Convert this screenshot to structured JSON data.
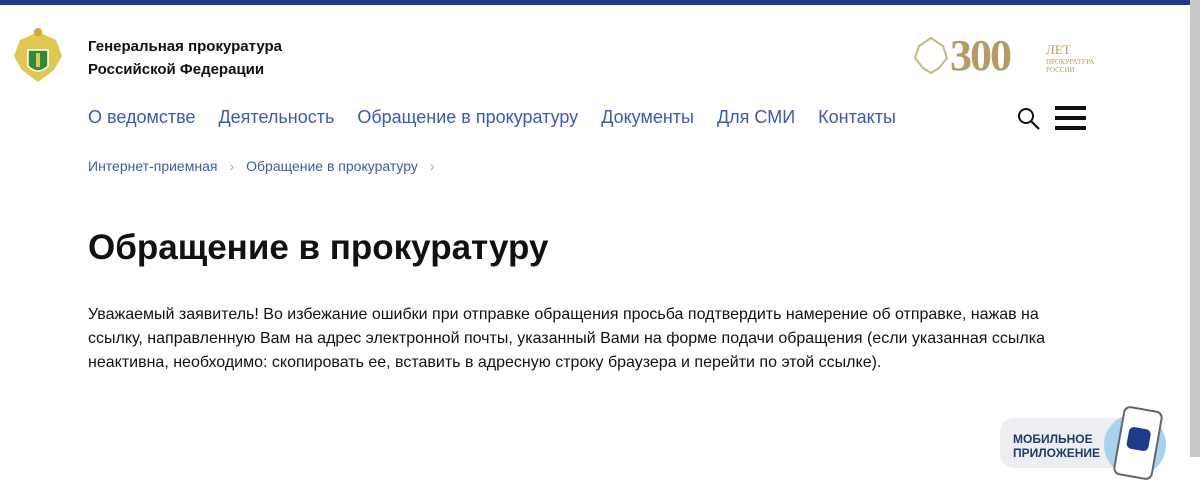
{
  "header": {
    "org_line1": "Генеральная прокуратура",
    "org_line2": "Российской Федерации",
    "jubilee": {
      "number": "300",
      "line1": "ЛЕТ",
      "line2": "ПРОКУРАТУРА",
      "line3": "РОССИИ"
    }
  },
  "nav": [
    "О ведомстве",
    "Деятельность",
    "Обращение в прокуратуру",
    "Документы",
    "Для СМИ",
    "Контакты"
  ],
  "breadcrumbs": [
    "Интернет-приемная",
    "Обращение в прокуратуру"
  ],
  "page": {
    "title": "Обращение в прокуратуру",
    "notice": "Уважаемый заявитель! Во избежание ошибки при отправке обращения просьба подтвердить намерение об отправке, нажав на ссылку, направленную Вам на адрес электронной почты, указанный Вами на форме подачи обращения (если указанная ссылка неактивна, необходимо: скопировать ее, вставить в адресную строку браузера и перейти по этой ссылке)."
  },
  "app_banner": {
    "line1": "МОБИЛЬНОЕ",
    "line2": "ПРИЛОЖЕНИЕ"
  },
  "colors": {
    "brand": "#1f3a8a",
    "link": "#3a5ab8",
    "gold": "#b59a64"
  }
}
